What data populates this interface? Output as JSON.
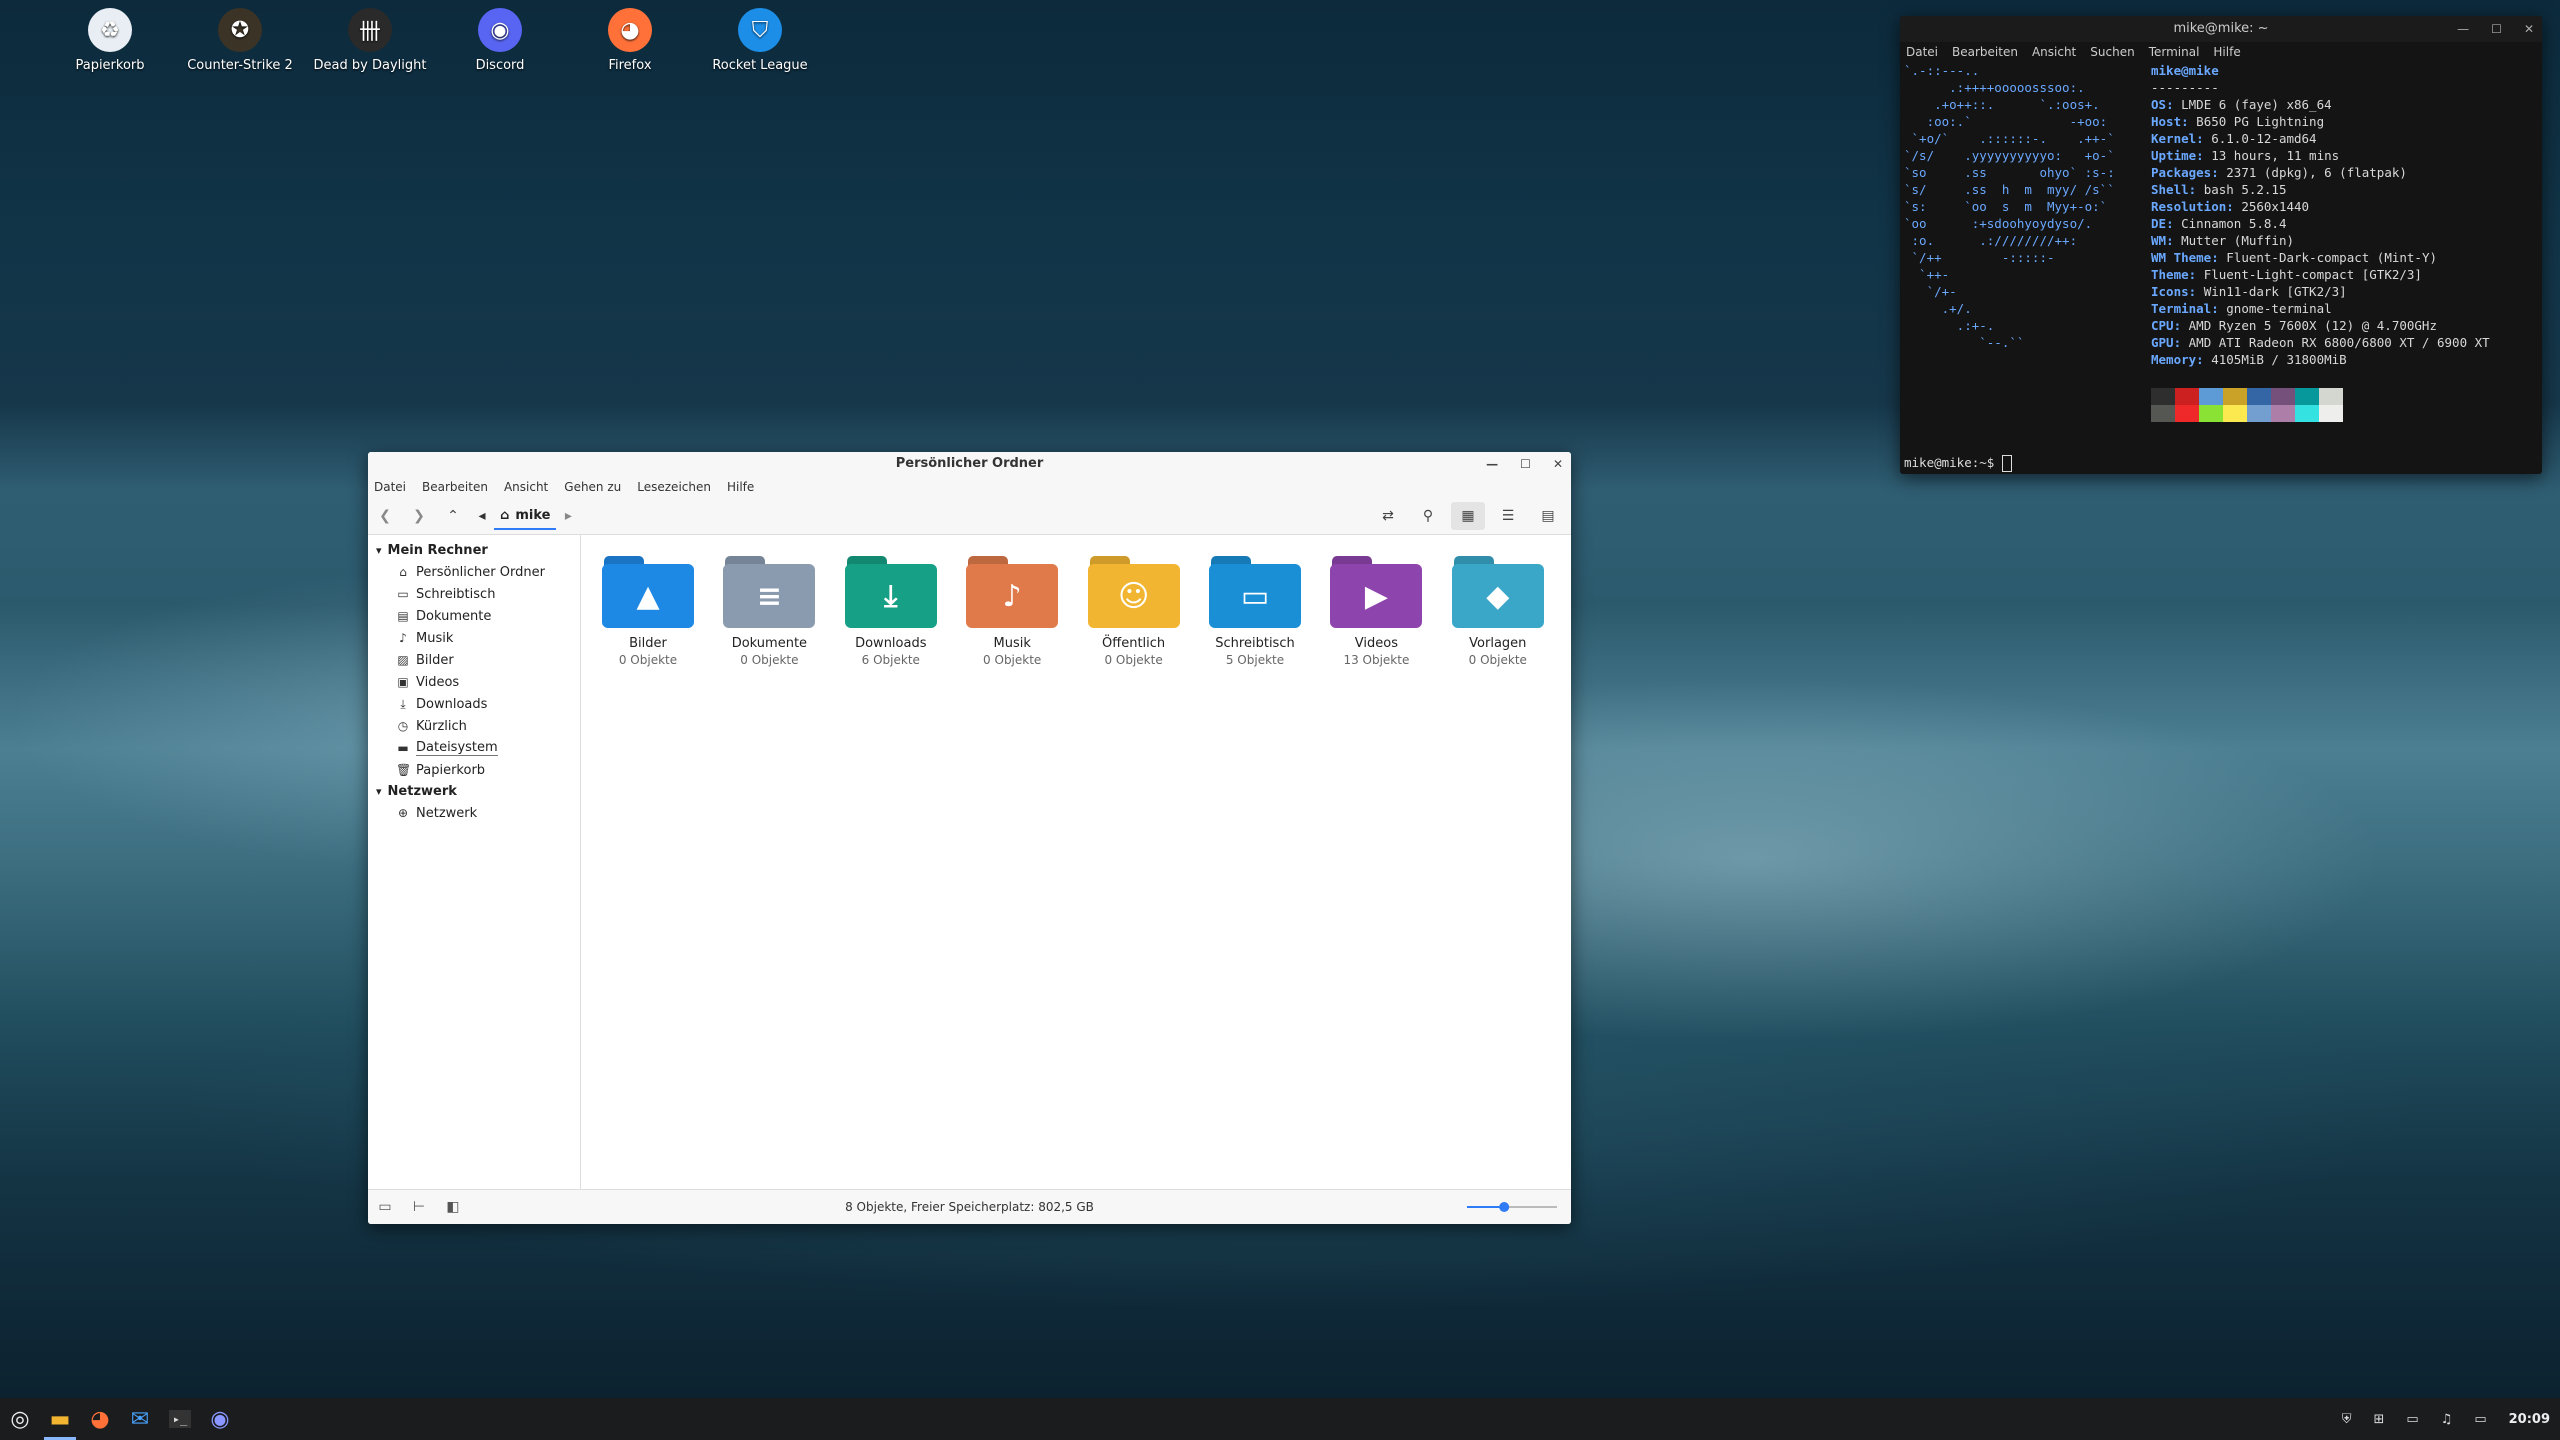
{
  "desktop": {
    "icons": [
      {
        "label": "Papierkorb",
        "icon": "trash-icon",
        "color": "#e8eef4"
      },
      {
        "label": "Counter-Strike 2",
        "icon": "cs2-icon",
        "color": "#3a3326"
      },
      {
        "label": "Dead by Daylight",
        "icon": "dbd-icon",
        "color": "#2a2a2a"
      },
      {
        "label": "Discord",
        "icon": "discord-icon",
        "color": "#5865f2"
      },
      {
        "label": "Firefox",
        "icon": "firefox-icon",
        "color": "#ff7139"
      },
      {
        "label": "Rocket League",
        "icon": "rocket-league-icon",
        "color": "#1c8ee8"
      }
    ]
  },
  "file_manager": {
    "title": "Persönlicher Ordner",
    "menu": [
      "Datei",
      "Bearbeiten",
      "Ansicht",
      "Gehen zu",
      "Lesezeichen",
      "Hilfe"
    ],
    "breadcrumb": "mike",
    "sidebar": {
      "sections": [
        {
          "header": "Mein Rechner",
          "items": [
            {
              "label": "Persönlicher Ordner",
              "icon": "home-icon"
            },
            {
              "label": "Schreibtisch",
              "icon": "desktop-icon"
            },
            {
              "label": "Dokumente",
              "icon": "document-icon"
            },
            {
              "label": "Musik",
              "icon": "music-icon"
            },
            {
              "label": "Bilder",
              "icon": "image-icon"
            },
            {
              "label": "Videos",
              "icon": "video-icon"
            },
            {
              "label": "Downloads",
              "icon": "download-icon"
            },
            {
              "label": "Kürzlich",
              "icon": "clock-icon"
            },
            {
              "label": "Dateisystem",
              "icon": "drive-icon"
            },
            {
              "label": "Papierkorb",
              "icon": "trash-icon"
            }
          ]
        },
        {
          "header": "Netzwerk",
          "items": [
            {
              "label": "Netzwerk",
              "icon": "network-icon"
            }
          ]
        }
      ]
    },
    "folders": [
      {
        "name": "Bilder",
        "count": "0 Objekte",
        "color": "#1e88e5",
        "glyph": "▲"
      },
      {
        "name": "Dokumente",
        "count": "0 Objekte",
        "color": "#8a9bb0",
        "glyph": "≡"
      },
      {
        "name": "Downloads",
        "count": "6 Objekte",
        "color": "#16a085",
        "glyph": "⤓"
      },
      {
        "name": "Musik",
        "count": "0 Objekte",
        "color": "#e07a4b",
        "glyph": "♪"
      },
      {
        "name": "Öffentlich",
        "count": "0 Objekte",
        "color": "#f2b531",
        "glyph": "☺"
      },
      {
        "name": "Schreibtisch",
        "count": "5 Objekte",
        "color": "#1a8fd6",
        "glyph": "▭"
      },
      {
        "name": "Videos",
        "count": "13 Objekte",
        "color": "#8e44ad",
        "glyph": "▶"
      },
      {
        "name": "Vorlagen",
        "count": "0 Objekte",
        "color": "#3aa7c9",
        "glyph": "◆"
      }
    ],
    "status": "8 Objekte, Freier Speicherplatz: 802,5 GB",
    "zoom_level": 0.4
  },
  "terminal": {
    "title": "mike@mike: ~",
    "menu": [
      "Datei",
      "Bearbeiten",
      "Ansicht",
      "Suchen",
      "Terminal",
      "Hilfe"
    ],
    "logo": [
      "`.-::---..",
      "      .:++++ooooosssoo:.",
      "    .+o++::.      `.:oos+.",
      "   :oo:.`             -+oo:",
      " `+o/`    .::::::-.    .++-`",
      "`/s/    .yyyyyyyyyyo:   +o-`",
      "`so     .ss       ohyo` :s-:",
      "`s/     .ss  h  m  myy/ /s``",
      "`s:     `oo  s  m  Myy+-o:`",
      "`oo      :+sdoohyoydyso/.",
      " :o.      .:////////++:",
      " `/++        -:::::-",
      "  `++-",
      "   `/+-",
      "     .+/.",
      "       .:+-.",
      "          `--.``"
    ],
    "user_host": "mike@mike",
    "separator": "---------",
    "info": [
      {
        "key": "OS",
        "value": "LMDE 6 (faye) x86_64"
      },
      {
        "key": "Host",
        "value": "B650 PG Lightning"
      },
      {
        "key": "Kernel",
        "value": "6.1.0-12-amd64"
      },
      {
        "key": "Uptime",
        "value": "13 hours, 11 mins"
      },
      {
        "key": "Packages",
        "value": "2371 (dpkg), 6 (flatpak)"
      },
      {
        "key": "Shell",
        "value": "bash 5.2.15"
      },
      {
        "key": "Resolution",
        "value": "2560x1440"
      },
      {
        "key": "DE",
        "value": "Cinnamon 5.8.4"
      },
      {
        "key": "WM",
        "value": "Mutter (Muffin)"
      },
      {
        "key": "WM Theme",
        "value": "Fluent-Dark-compact (Mint-Y)"
      },
      {
        "key": "Theme",
        "value": "Fluent-Light-compact [GTK2/3]"
      },
      {
        "key": "Icons",
        "value": "Win11-dark [GTK2/3]"
      },
      {
        "key": "Terminal",
        "value": "gnome-terminal"
      },
      {
        "key": "CPU",
        "value": "AMD Ryzen 5 7600X (12) @ 4.700GHz"
      },
      {
        "key": "GPU",
        "value": "AMD ATI Radeon RX 6800/6800 XT / 6900 XT"
      },
      {
        "key": "Memory",
        "value": "4105MiB / 31800MiB"
      }
    ],
    "palette": [
      "#2e2e2e",
      "#cc1f1f",
      "#5c9bd6",
      "#c9a227",
      "#3465a4",
      "#75507b",
      "#06989a",
      "#d3d7cf",
      "#555753",
      "#ef2929",
      "#8ae234",
      "#fce94f",
      "#729fcf",
      "#ad7fa8",
      "#34e2e2",
      "#eeeeec"
    ],
    "prompt": "mike@mike:~$ "
  },
  "taskbar": {
    "apps": [
      {
        "name": "menu",
        "icon": "mint-menu-icon"
      },
      {
        "name": "files",
        "icon": "folder-icon"
      },
      {
        "name": "firefox",
        "icon": "firefox-icon"
      },
      {
        "name": "mail",
        "icon": "mail-icon"
      },
      {
        "name": "terminal",
        "icon": "terminal-icon"
      },
      {
        "name": "discord",
        "icon": "discord-icon"
      }
    ],
    "clock": "20:09"
  }
}
